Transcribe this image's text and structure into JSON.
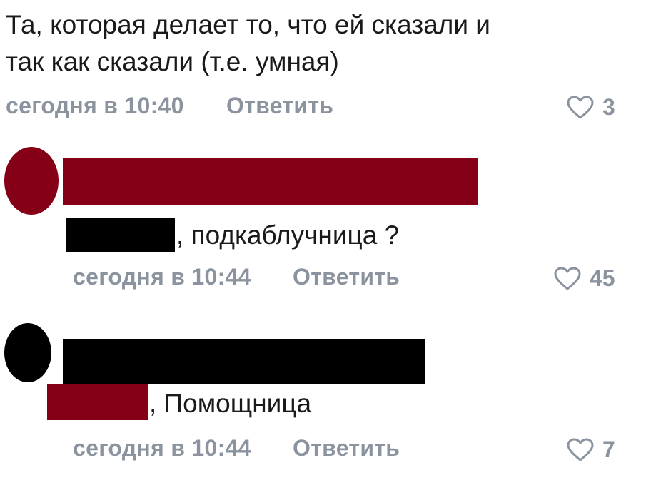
{
  "colors": {
    "meta_gray": "#8b949e",
    "redact_red": "#850016",
    "redact_black": "#000000"
  },
  "comments": [
    {
      "text_line1": "Та, которая делает то, что ей сказали и",
      "text_line2": "так как сказали (т.е. умная)",
      "timestamp": "сегодня в 10:40",
      "reply_label": "Ответить",
      "like_icon": "heart-outline-icon",
      "likes": "3"
    },
    {
      "avatar_color": "#850016",
      "text_suffix": ", подкаблучница ?",
      "timestamp": "сегодня в 10:44",
      "reply_label": "Ответить",
      "like_icon": "heart-outline-icon",
      "likes": "45"
    },
    {
      "avatar_color": "#000000",
      "text_suffix": ", Помощница",
      "timestamp": "сегодня в 10:44",
      "reply_label": "Ответить",
      "like_icon": "heart-outline-icon",
      "likes": "7"
    }
  ]
}
